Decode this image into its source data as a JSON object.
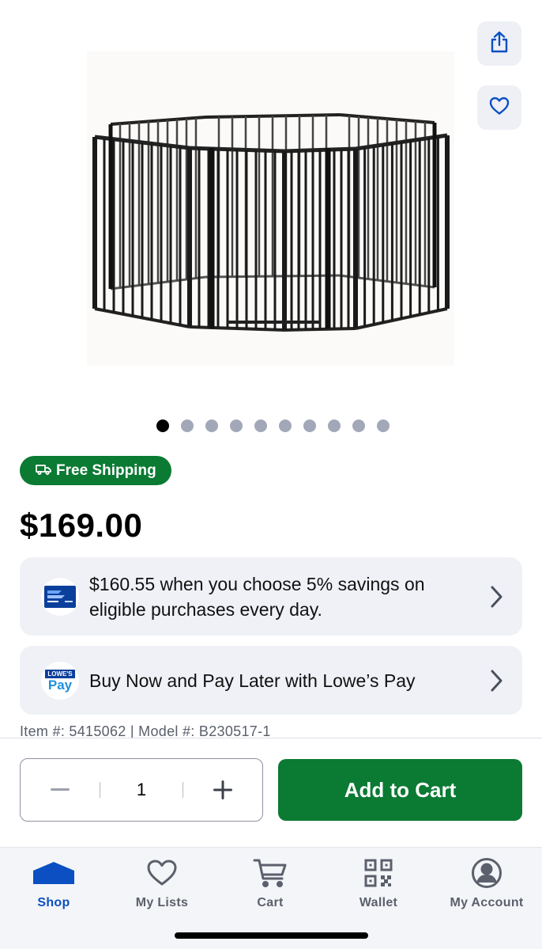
{
  "actions": {
    "share_icon": "share-icon",
    "favorite_icon": "heart-icon"
  },
  "product": {
    "image_alt": "Black octagonal metal pet/baby playpen gate",
    "image_count": 10,
    "current_image": 1,
    "shipping_badge": "Free Shipping",
    "price": "$169.00",
    "item_line": "Item #: 5415062 | Model #: B230517-1"
  },
  "promos": {
    "savings_text": "$160.55 when you choose 5% savings on eligible purchases every day.",
    "pay_text": "Buy Now and Pay Later with Lowe’s Pay",
    "pay_logo_top": "LOWE'S",
    "pay_logo_bottom": "Pay"
  },
  "cart": {
    "quantity": "1",
    "add_label": "Add to Cart"
  },
  "tabs": [
    {
      "label": "Shop",
      "icon": "home-icon",
      "active": true
    },
    {
      "label": "My Lists",
      "icon": "heart-icon",
      "active": false
    },
    {
      "label": "Cart",
      "icon": "cart-icon",
      "active": false
    },
    {
      "label": "Wallet",
      "icon": "qr-code-icon",
      "active": false
    },
    {
      "label": "My Account",
      "icon": "account-icon",
      "active": false
    }
  ],
  "colors": {
    "brand_green": "#0b7a33",
    "brand_blue": "#0b4fc2",
    "card_bg": "#eff1f7"
  }
}
